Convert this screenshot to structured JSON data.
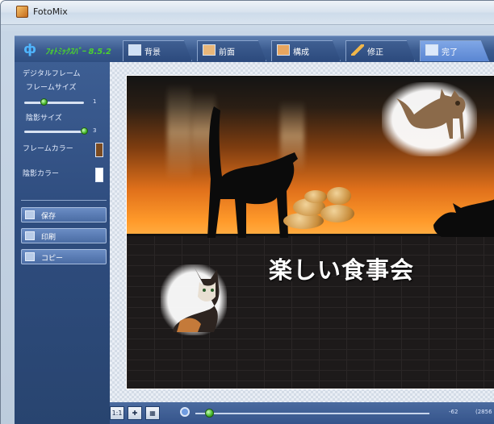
{
  "window": {
    "title": "FotoMix"
  },
  "toolbar": {
    "brand": "ﾌｫﾄﾐｯｸｽﾊﾞｰ 8.5.2",
    "tabs": [
      {
        "label": "背景",
        "icon": "background-icon"
      },
      {
        "label": "前面",
        "icon": "foreground-icon"
      },
      {
        "label": "構成",
        "icon": "compose-icon"
      },
      {
        "label": "修正",
        "icon": "pencil-icon"
      },
      {
        "label": "完了",
        "icon": "done-icon",
        "active": true
      }
    ]
  },
  "left_panel": {
    "section_title": "デジタルフレーム",
    "frame_size": {
      "label": "フレームサイズ",
      "value": "1"
    },
    "shadow_size": {
      "label": "陰影サイズ",
      "value": "3"
    },
    "frame_color": {
      "label": "フレームカラー",
      "color": "#7a4a20"
    },
    "shadow_color": {
      "label": "陰影カラー",
      "color": "#ffffff"
    },
    "buttons": [
      {
        "label": "保存",
        "icon": "save-icon"
      },
      {
        "label": "印刷",
        "icon": "print-icon"
      },
      {
        "label": "コピー",
        "icon": "copy-icon"
      }
    ]
  },
  "canvas": {
    "text": "楽しい食事会"
  },
  "bottom_bar": {
    "zoom_value": "-62",
    "coordinate": "(2856"
  }
}
